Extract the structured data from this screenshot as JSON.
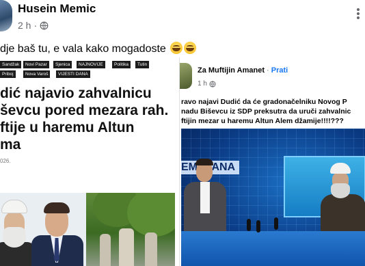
{
  "post": {
    "author": "Husein Memic",
    "time": "2 h",
    "meta_separator": "·",
    "text": "dje baš tu, e vala kako mogadoste"
  },
  "article": {
    "tags": [
      "Sandžak",
      "Novi Pazar",
      "Sjenica",
      "NAJNOVIJE",
      "Politika",
      "Tutin",
      "Priboj",
      "Nova Varoš",
      "VIJESTI DANA"
    ],
    "headline_lines": [
      "dić najavio zahvalnicu",
      "ševcu pored mezara rah.",
      "ftije u haremu Altun",
      "ma"
    ],
    "date": "026."
  },
  "shared_post": {
    "author": "Za Muftijin Amanet",
    "separator": "·",
    "follow_label": "Prati",
    "time": "1 h",
    "text_lines": [
      "ravo najavi Dudić da će gradonačelniku Novog P",
      "nadu Biševcu iz SDP preksutra da uruči zahvalnic",
      "ftijin mezar u haremu Altun Alem džamije!!!!???"
    ],
    "tv_banner": "EMI DANA"
  },
  "colors": {
    "link": "#1877f2",
    "secondary_text": "#65676b",
    "tag_bg": "#1c1c1c"
  },
  "icons": [
    "globe-icon",
    "more-options-icon",
    "laughing-emoji-icon"
  ]
}
